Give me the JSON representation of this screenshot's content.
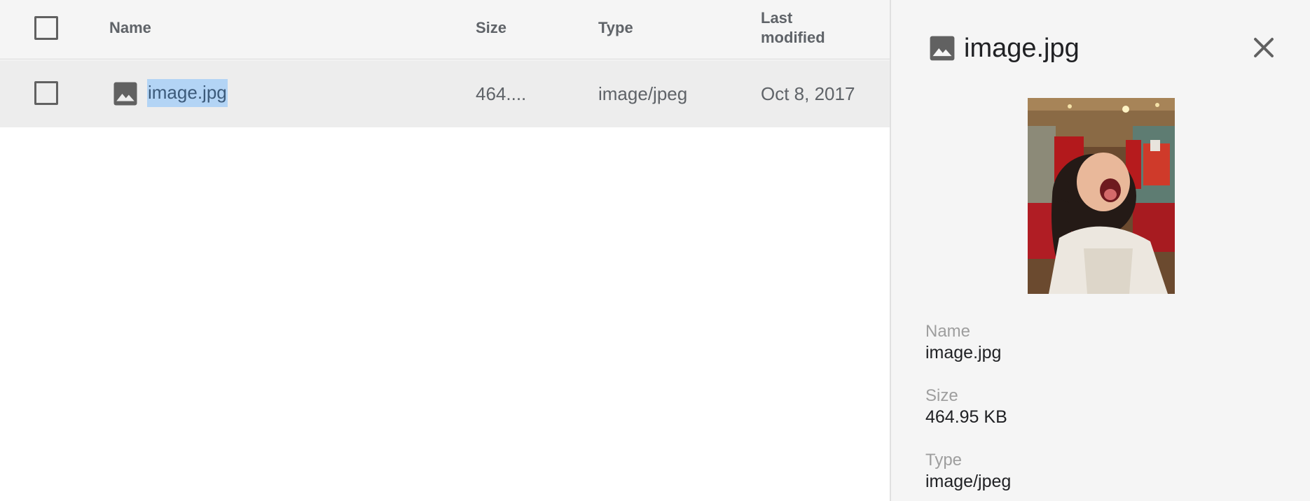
{
  "list": {
    "headers": {
      "name": "Name",
      "size": "Size",
      "type": "Type",
      "last_modified_line1": "Last",
      "last_modified_line2": "modified"
    },
    "rows": [
      {
        "name": "image.jpg",
        "size": "464....",
        "type": "image/jpeg",
        "modified": "Oct 8, 2017",
        "icon": "image-file-icon",
        "selected_text": true
      }
    ]
  },
  "details": {
    "title": "image.jpg",
    "title_icon": "image-file-icon",
    "close_icon": "close-icon",
    "fields": [
      {
        "label": "Name",
        "value": "image.jpg"
      },
      {
        "label": "Size",
        "value": "464.95 KB"
      },
      {
        "label": "Type",
        "value": "image/jpeg"
      }
    ]
  },
  "colors": {
    "header_bg": "#f5f5f5",
    "row_bg": "#ededed",
    "selection": "#b3d4f5",
    "panel_bg": "#f5f5f5",
    "icon": "#616161"
  }
}
